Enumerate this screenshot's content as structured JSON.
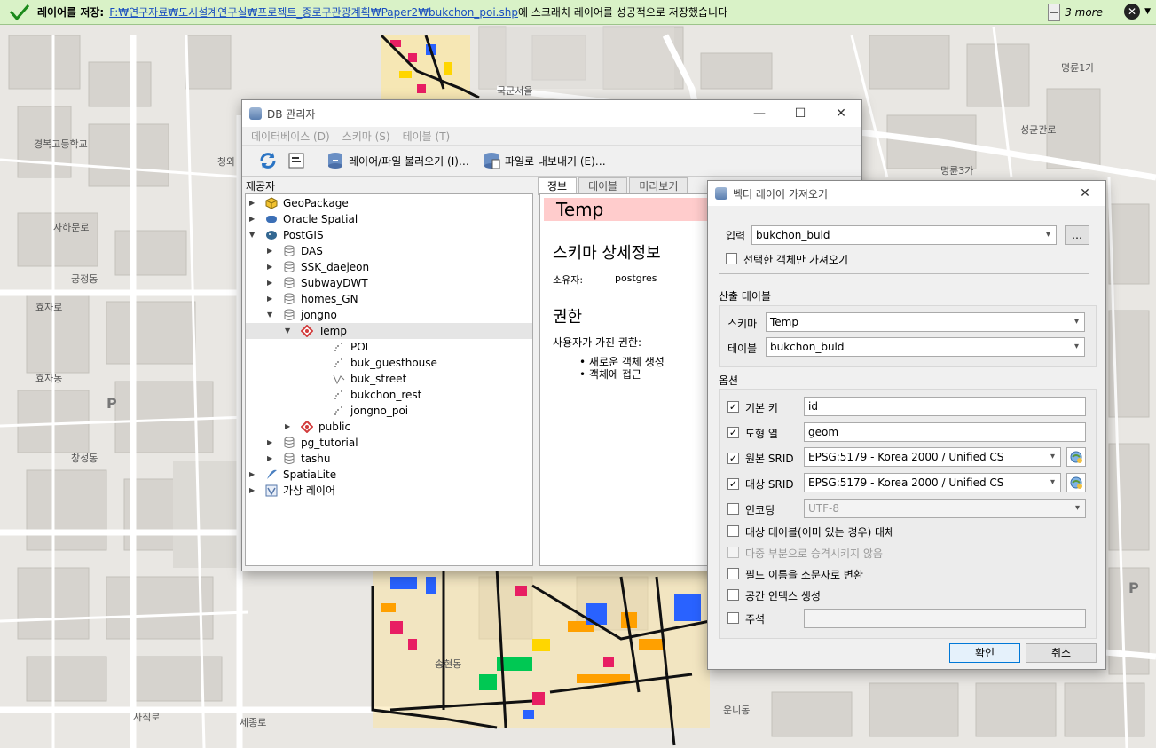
{
  "message_bar": {
    "title": "레이어를 저장:",
    "path_link": "F:₩연구자료₩도시설계연구실₩프로젝트_종로구관광계획₩Paper2₩bukchon_poi.shp",
    "message_rest": "에 스크래치 레이어를 성공적으로 저장했습니다",
    "more_label": "3 more",
    "close_symbol": "✕",
    "menu_symbol": "▼"
  },
  "map_labels": {
    "l1": "국군서울",
    "l2": "명륜1가",
    "l3": "명륜3가",
    "l4": "청와",
    "l5": "궁정동",
    "l6": "효자동",
    "l7": "창성동",
    "l8": "송현동",
    "l9": "세종로",
    "l10": "운니동",
    "l11": "경복고등학교",
    "l12": "사직로",
    "l13": "효자로",
    "l14": "자하문로",
    "l15": "성균관로",
    "l16": "P"
  },
  "db_manager": {
    "title": "DB 관리자",
    "menu": [
      "데이터베이스 (D)",
      "스키마 (S)",
      "테이블 (T)"
    ],
    "toolbar": {
      "import_label": "레이어/파일 불러오기 (I)…",
      "export_label": "파일로 내보내기 (E)…"
    },
    "providers_header": "제공자",
    "tree": [
      {
        "label": "GeoPackage",
        "icon": "geopackage-icon",
        "level": 0,
        "arrow": "▶"
      },
      {
        "label": "Oracle Spatial",
        "icon": "oracle-icon",
        "level": 0,
        "arrow": "▶"
      },
      {
        "label": "PostGIS",
        "icon": "postgis-icon",
        "level": 0,
        "arrow": "▼"
      },
      {
        "label": "DAS",
        "icon": "schema-icon",
        "level": 1,
        "arrow": "▶"
      },
      {
        "label": "SSK_daejeon",
        "icon": "schema-icon",
        "level": 1,
        "arrow": "▶"
      },
      {
        "label": "SubwayDWT",
        "icon": "schema-icon",
        "level": 1,
        "arrow": "▶"
      },
      {
        "label": "homes_GN",
        "icon": "schema-icon",
        "level": 1,
        "arrow": "▶"
      },
      {
        "label": "jongno",
        "icon": "schema-icon",
        "level": 1,
        "arrow": "▼"
      },
      {
        "label": "Temp",
        "icon": "schema-diamond-icon",
        "level": 2,
        "arrow": "▼"
      },
      {
        "label": "POI",
        "icon": "point-layer-icon",
        "level": 3,
        "arrow": ""
      },
      {
        "label": "buk_guesthouse",
        "icon": "point-layer-icon",
        "level": 3,
        "arrow": ""
      },
      {
        "label": "buk_street",
        "icon": "line-layer-icon",
        "level": 3,
        "arrow": ""
      },
      {
        "label": "bukchon_rest",
        "icon": "point-layer-icon",
        "level": 3,
        "arrow": ""
      },
      {
        "label": "jongno_poi",
        "icon": "point-layer-icon",
        "level": 3,
        "arrow": ""
      },
      {
        "label": "public",
        "icon": "schema-diamond-icon",
        "level": 2,
        "arrow": "▶"
      },
      {
        "label": "pg_tutorial",
        "icon": "schema-icon",
        "level": 1,
        "arrow": "▶"
      },
      {
        "label": "tashu",
        "icon": "schema-icon",
        "level": 1,
        "arrow": "▶"
      },
      {
        "label": "SpatiaLite",
        "icon": "spatialite-icon",
        "level": 0,
        "arrow": "▶"
      },
      {
        "label": "가상 레이어",
        "icon": "virtual-layer-icon",
        "level": 0,
        "arrow": "▶"
      }
    ],
    "tabs": [
      "정보",
      "테이블",
      "미리보기"
    ],
    "info": {
      "header": "Temp",
      "schema_heading": "스키마 상세정보",
      "owner_label": "소유자:",
      "owner_value": "postgres",
      "perm_heading": "권한",
      "perm_text": "사용자가 가진 권한:",
      "perms": [
        "새로운 객체 생성",
        "객체에 접근"
      ]
    }
  },
  "import_dialog": {
    "title": "벡터 레이어 가져오기",
    "input_label": "입력",
    "input_value": "bukchon_buld",
    "browse_label": "…",
    "selected_only_label": "선택한 객체만 가져오기",
    "output_section": "산출 테이블",
    "schema_label": "스키마",
    "schema_value": "Temp",
    "table_label": "테이블",
    "table_value": "bukchon_buld",
    "options_section": "옵션",
    "options": {
      "primary_key_label": "기본 키",
      "primary_key_value": "id",
      "geom_col_label": "도형 열",
      "geom_col_value": "geom",
      "source_srid_label": "원본 SRID",
      "source_srid_value": "EPSG:5179 - Korea 2000 / Unified CS",
      "target_srid_label": "대상 SRID",
      "target_srid_value": "EPSG:5179 - Korea 2000 / Unified CS",
      "encoding_label": "인코딩",
      "encoding_value": "UTF-8",
      "replace_label": "대상 테이블(이미 있는 경우) 대체",
      "no_multipart_label": "다중 부분으로 승격시키지 않음",
      "lowercase_label": "필드 이름을 소문자로 변환",
      "spatial_index_label": "공간 인덱스 생성",
      "comment_label": "주석"
    },
    "ok_label": "확인",
    "cancel_label": "취소"
  },
  "colors": {
    "message_bg": "#d9f2c7",
    "info_header_bg": "#ffcccc",
    "default_button_border": "#0078d7"
  }
}
